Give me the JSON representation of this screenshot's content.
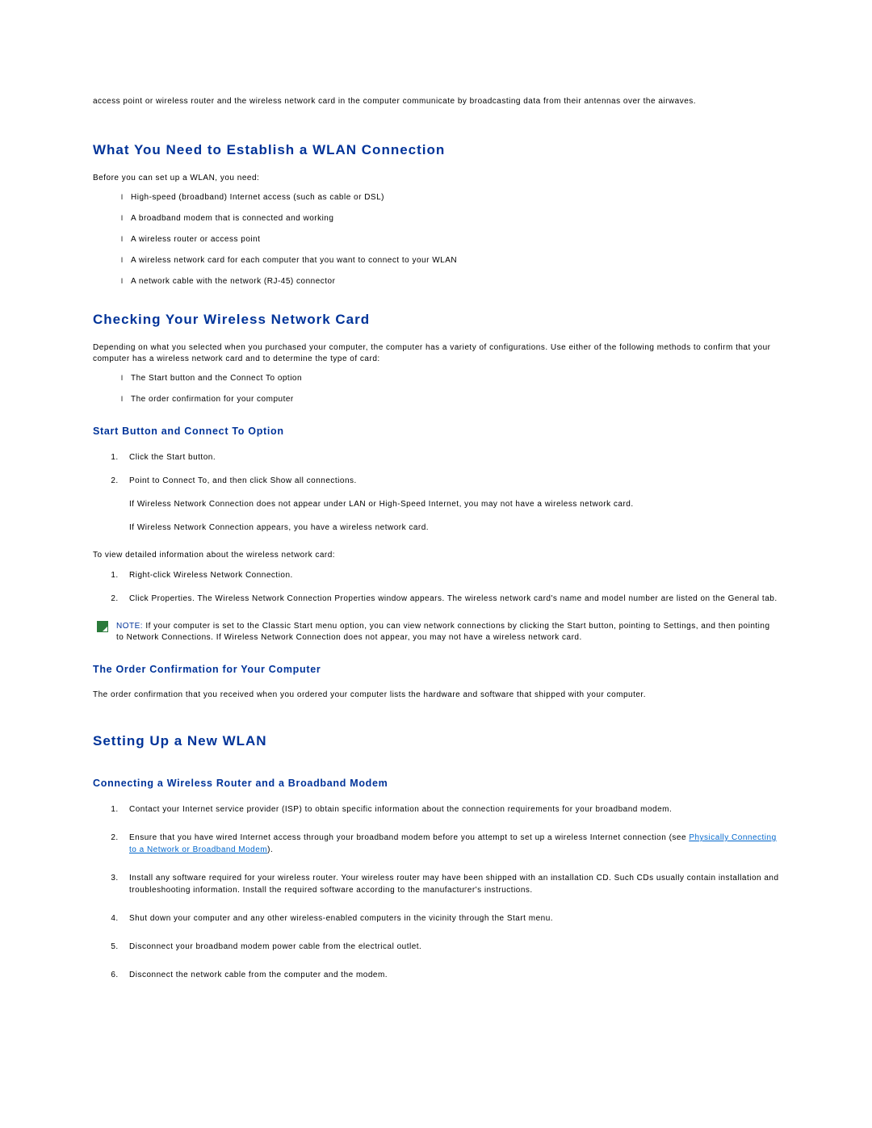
{
  "intro": "access point or wireless router and the wireless network card in the computer communicate by broadcasting data from their antennas over the airwaves.",
  "section1": {
    "heading": "What You Need to Establish a WLAN Connection",
    "lead": "Before you can set up a WLAN, you need:",
    "bullets": [
      "High-speed (broadband) Internet access (such as cable or DSL)",
      "A broadband modem that is connected and working",
      "A wireless router or access point",
      "A wireless network card for each computer that you want to connect to your WLAN",
      "A network cable with the network (RJ-45) connector"
    ]
  },
  "section2": {
    "heading": "Checking Your Wireless Network Card",
    "lead": "Depending on what you selected when you purchased your computer, the computer has a variety of configurations. Use either of the following methods to confirm that your computer has a wireless network card and to determine the type of card:",
    "bullets": [
      "The Start button and the Connect To option",
      "The order confirmation for your computer"
    ],
    "sub1": {
      "heading": "Start Button and Connect To Option",
      "step1": "Click the Start button.",
      "step2": "Point to Connect To, and then click Show all connections.",
      "step2_extra1": "If Wireless Network Connection does not appear under LAN or High-Speed Internet, you may not have a wireless network card.",
      "step2_extra2": "If Wireless Network Connection appears, you have a wireless network card.",
      "detail_lead": "To view detailed information about the wireless network card:",
      "detail1": "Right-click Wireless Network Connection.",
      "detail2": "Click Properties. The Wireless Network Connection Properties window appears. The wireless network card's name and model number are listed on the General tab.",
      "note_label": "NOTE:",
      "note_body": " If your computer is set to the Classic Start menu option, you can view network connections by clicking the Start button, pointing to Settings, and then pointing to Network Connections. If Wireless Network Connection does not appear, you may not have a wireless network card."
    },
    "sub2": {
      "heading": "The Order Confirmation for Your Computer",
      "body": "The order confirmation that you received when you ordered your computer lists the hardware and software that shipped with your computer."
    }
  },
  "section3": {
    "heading": "Setting Up a New WLAN",
    "sub1": {
      "heading": "Connecting a Wireless Router and a Broadband Modem",
      "step1": "Contact your Internet service provider (ISP) to obtain specific information about the connection requirements for your broadband modem.",
      "step2_a": "Ensure that you have wired Internet access through your broadband modem before you attempt to set up a wireless Internet connection (see ",
      "step2_link": "Physically Connecting to a Network or Broadband Modem",
      "step2_b": ").",
      "step3": "Install any software required for your wireless router. Your wireless router may have been shipped with an installation CD. Such CDs usually contain installation and troubleshooting information. Install the required software according to the manufacturer's instructions.",
      "step4": "Shut down your computer and any other wireless-enabled computers in the vicinity through the Start menu.",
      "step5": "Disconnect your broadband modem power cable from the electrical outlet.",
      "step6": "Disconnect the network cable from the computer and the modem."
    }
  }
}
